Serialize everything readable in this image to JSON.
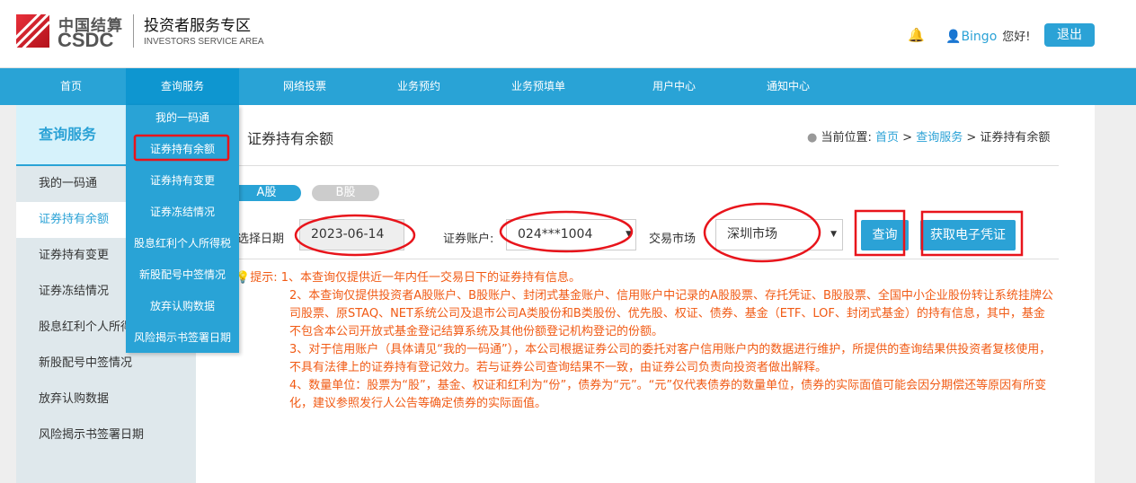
{
  "header": {
    "logo_cn": "中国结算",
    "logo_en": "CSDC",
    "title": "投资者服务专区",
    "subtitle": "INVESTORS SERVICE AREA",
    "username": "Bingo",
    "greeting": "您好!",
    "logout": "退出",
    "icons": [
      "bell-icon",
      "user-icon"
    ]
  },
  "nav": [
    "首页",
    "查询服务",
    "网络投票",
    "业务预约",
    "业务预填单",
    "用户中心",
    "通知中心"
  ],
  "dropdown": [
    "我的一码通",
    "证券持有余额",
    "证券持有变更",
    "证券冻结情况",
    "股息红利个人所得税",
    "新股配号中签情况",
    "放弃认购数据",
    "风险揭示书签署日期"
  ],
  "sidebar": {
    "title": "查询服务",
    "items": [
      "我的一码通",
      "证券持有余额",
      "证券持有变更",
      "证券冻结情况",
      "股息红利个人所得税",
      "新股配号中签情况",
      "放弃认购数据",
      "风险揭示书签署日期"
    ]
  },
  "page": {
    "title": "证券持有余额",
    "crumb_label": "当前位置:",
    "crumb": [
      "首页",
      "查询服务",
      "证券持有余额"
    ],
    "sep": ">"
  },
  "tabs": [
    "A股",
    "B股"
  ],
  "form": {
    "date_label": "选择日期",
    "date": "2023-06-14",
    "account_label": "证券账户:",
    "account": "024***1004",
    "market_label": "交易市场",
    "market": "深圳市场",
    "query": "查询",
    "voucher": "获取电子凭证"
  },
  "tips": {
    "label": "提示:",
    "lines": [
      "1、本查询仅提供近一年内任一交易日下的证券持有信息。",
      "2、本查询仅提供投资者A股账户、B股账户、封闭式基金账户、信用账户中记录的A股股票、存托凭证、B股股票、全国中小企业股份转让系统挂牌公司股票、原STAQ、NET系统公司及退市公司A类股份和B类股份、优先股、权证、债券、基金（ETF、LOF、封闭式基金）的持有信息，其中，基金不包含本公司开放式基金登记结算系统及其他份额登记机构登记的份额。",
      "3、对于信用账户（具体请见“我的一码通”），本公司根据证券公司的委托对客户信用账户内的数据进行维护，所提供的查询结果供投资者复核使用，不具有法律上的证券持有登记效力。若与证券公司查询结果不一致，由证券公司负责向投资者做出解释。",
      "4、数量单位：股票为“股”，基金、权证和红利为“份”，债券为“元”。“元”仅代表债券的数量单位，债券的实际面值可能会因分期偿还等原因有所变化，建议参照发行人公告等确定债券的实际面值。"
    ]
  },
  "colors": {
    "brand": "#29a3d6",
    "annotation": "#e8141b",
    "tips": "#f15a14"
  }
}
